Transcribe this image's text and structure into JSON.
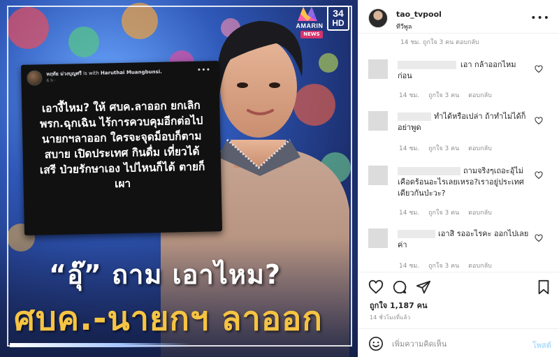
{
  "image": {
    "channel_logo_text": "AMARIN",
    "channel_badge": "NEWS",
    "channel_number": "34",
    "channel_hd": "HD",
    "fb_post": {
      "author": "หฤทัย ม่วงบุญศรี",
      "with_text": "is with",
      "with_name": "Haruthai Muangbunsi.",
      "time": "6 h ·",
      "body": "เอางี้ไหม? ให้ ศบค.ลาออก ยกเลิก พรก.ฉุกเฉิน ไร้การควบคุมอีกต่อไป นายกฯลาออก ใครจะจุดม็อบก็ตามสบาย เปิดประเทศ กินดื่ม เที่ยวได้เสรี ป่วยรักษาเอง ไปไหนก็ได้ ตายก็เผา"
    },
    "headline_1": "“อุ๊” ถาม เอาไหม?",
    "headline_2": "ศบค.-นายกฯ ลาออก"
  },
  "profile": {
    "username": "tao_tvpool",
    "location": "ทีวีพูล",
    "more": "•••"
  },
  "comments": {
    "cut_top": "14 ชม.  ถูกใจ 3 คน  ตอบกลับ",
    "items": [
      {
        "text": "เอา กล้าออกไหมก่อน",
        "time": "14 ชม.",
        "likes": "ถูกใจ 3 คน",
        "reply": "ตอบกลับ"
      },
      {
        "text": "ทำได้หรือเปล่า ถ้าทำไม่ได้ก็อย่าพูด",
        "time": "14 ชม.",
        "likes": "ถูกใจ 3 คน",
        "reply": "ตอบกลับ"
      },
      {
        "text": "ถามจริงๆเถอะอุ้ไม่เคือดร้อนอะไรเลยเหรอ?เราอยู่ประเทศเดียวกันป่ะวะ?",
        "time": "14 ชม.",
        "likes": "ถูกใจ 3 คน",
        "reply": "ตอบกลับ"
      },
      {
        "text": "เอาสิ รออะไรคะ ออกไปเลยค่า",
        "time": "14 ชม.",
        "likes": "ถูกใจ 3 คน",
        "reply": "ตอบกลับ"
      }
    ]
  },
  "stats": {
    "likes": "ถูกใจ 1,187 คน",
    "ago": "14 ชั่วโมงที่แล้ว"
  },
  "add_comment": {
    "placeholder": "เพิ่มความคิดเห็น",
    "post_label": "โพสต์"
  },
  "icons": {
    "heart": "heart-icon",
    "comment": "comment-icon",
    "share": "share-icon",
    "bookmark": "bookmark-icon",
    "smile": "smile-icon"
  },
  "colors": {
    "accent_yellow": "#f6c443",
    "post_button": "#b2dffc",
    "muted": "#8e8e8e"
  }
}
